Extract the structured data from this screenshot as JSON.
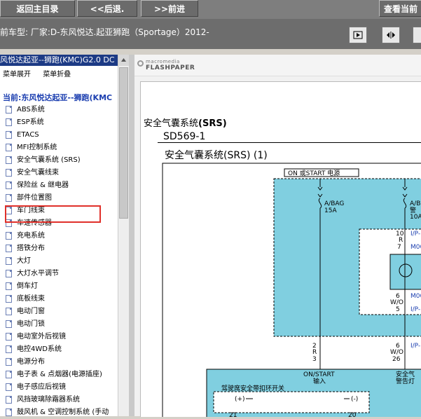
{
  "nav": {
    "home_label": "返回主目录",
    "back_label": "<<后退.",
    "forward_label": ">>前进",
    "view_current_label": "查看当前"
  },
  "model_bar": {
    "text": "前车型:   厂家:D-东风悦达.起亚狮跑（Sportage）2012-"
  },
  "left_panel": {
    "header": "风悦达起亚--狮跑(KMC)G2.0 DC",
    "expand_label": "菜单展开",
    "collapse_label": "菜单折叠",
    "current_label": "当前:东风悦达起亚--狮跑(KMC",
    "items": [
      "ABS系统",
      "ESP系统",
      "ETACS",
      "MFI控制系统",
      "安全气囊系统 (SRS)",
      "安全气囊线束",
      "保险丝 & 继电器",
      "部件位置图",
      "车门线束",
      "车速传感器",
      "充电系统",
      "搭铁分布",
      "大灯",
      "大灯水平调节",
      "倒车灯",
      "底板线束",
      "电动门窗",
      "电动门锁",
      "电动室外后视镜",
      "电控4WD系统",
      "电源分布",
      "电子表 & 点烟器(电源插座)",
      "电子感应后视镜",
      "风挡玻璃除霜器系统",
      "鼓风机 & 空调控制系统 (手动"
    ]
  },
  "viewer": {
    "logo_small": "macromedia",
    "logo_big": "FLASHPAPER"
  },
  "document": {
    "title_prefix": "安全气囊系统",
    "title_bold": "(SRS)",
    "code": "SD569-1",
    "subtitle": "安全气囊系统(SRS) (1)",
    "power_label": "ON 或START 电源",
    "fuse1_name": "A/BAG",
    "fuse1_amp": "15A",
    "fuse2_name": "A/B",
    "fuse2_desc": "警",
    "fuse2_amp": "10A",
    "conn_1": "I/P-",
    "conn_2": "M06",
    "conn_3": "M06",
    "conn_4": "I/P-",
    "conn_5": "I/P-",
    "pin_10": "10",
    "pin_r": "R",
    "pin_7": "7",
    "pin_6a": "6",
    "pin_wo_a": "W/O",
    "pin_5": "5",
    "pin_2": "2",
    "pin_r2": "R",
    "pin_3": "3",
    "pin_6b": "6",
    "pin_wo_b": "W/O",
    "pin_26": "26",
    "on_start": "ON/START",
    "input_label": "输入",
    "buckle_label": "驾驶席安全带扣环开关",
    "seat_label": "安全气",
    "warn_label": "警告灯",
    "plus_label": "(+)",
    "minus_label": "(-)",
    "pin_21": "21",
    "pin_20": "20"
  },
  "colors": {
    "cyan_fill": "#80cfe0",
    "highlight_border": "#e0302a",
    "tree_header": "#1c3a85",
    "current_text": "#1c3fb0"
  }
}
